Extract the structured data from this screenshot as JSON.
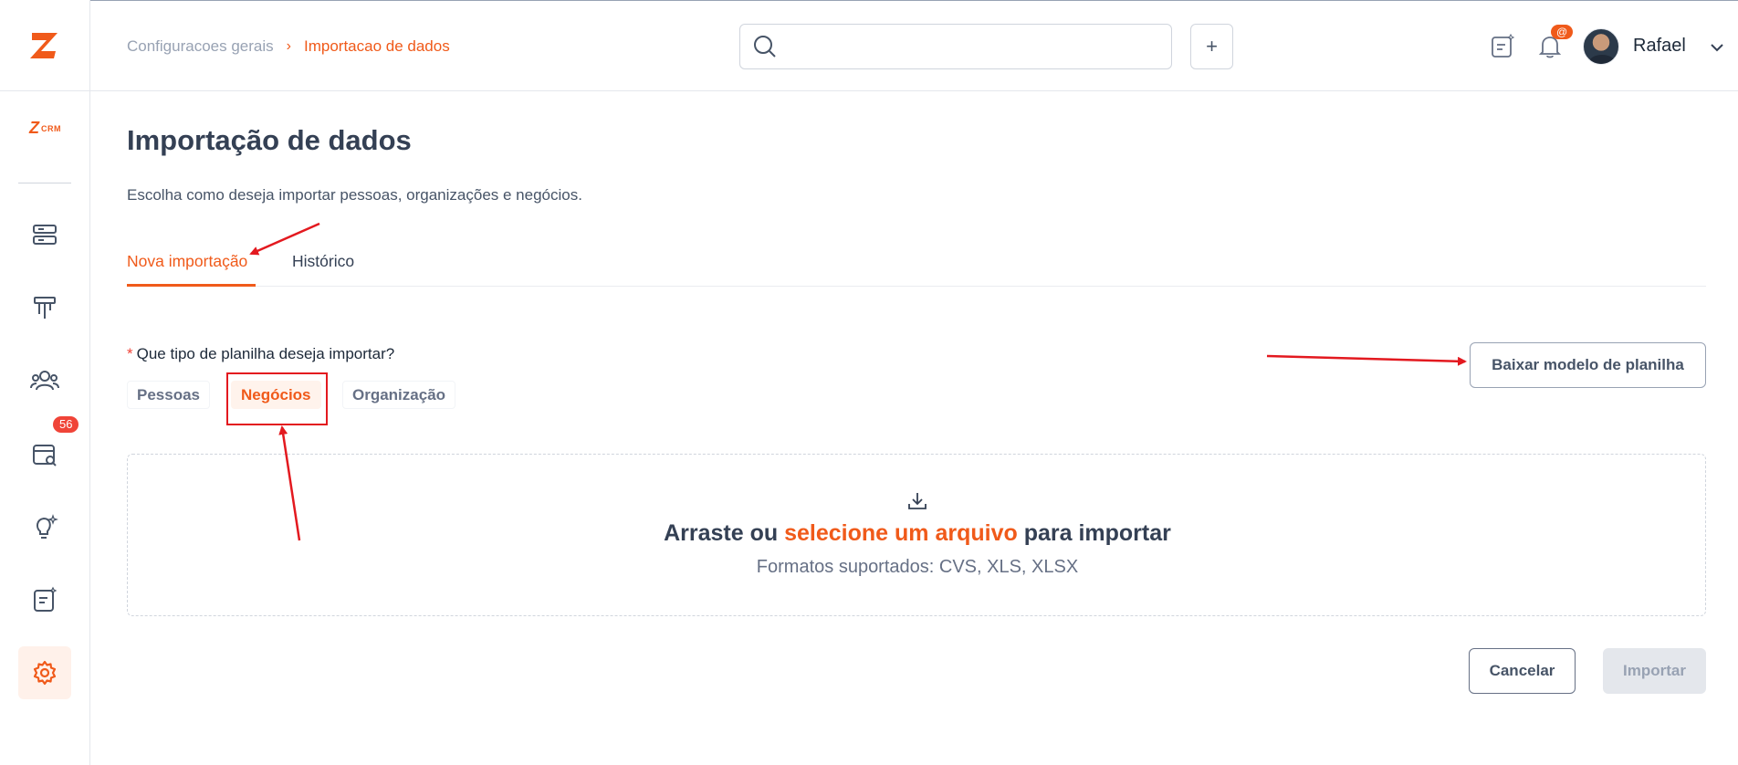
{
  "breadcrumb": {
    "parent": "Configuracoes gerais",
    "separator": "›",
    "current": "Importacao de dados"
  },
  "header": {
    "search_placeholder": "",
    "add_label": "+",
    "mention_badge": "@",
    "user_name": "Rafael"
  },
  "sidebar": {
    "logo_z": "Z",
    "crm_label": "CRM",
    "calendar_badge": "56",
    "items": [
      "dashboard-icon",
      "pipeline-icon",
      "contacts-icon",
      "calendar-search-icon",
      "idea-icon",
      "notes-icon",
      "settings-icon"
    ],
    "active": "settings-icon"
  },
  "page": {
    "title": "Importação de dados",
    "subtitle": "Escolha como deseja importar pessoas, organizações e negócios."
  },
  "tabs": [
    {
      "label": "Nova importação",
      "active": true
    },
    {
      "label": "Histórico",
      "active": false
    }
  ],
  "form": {
    "required_mark": "*",
    "question": "Que tipo de planilha deseja importar?",
    "options": [
      {
        "label": "Pessoas",
        "selected": false
      },
      {
        "label": "Negócios",
        "selected": true
      },
      {
        "label": "Organização",
        "selected": false
      }
    ],
    "download_template_label": "Baixar modelo de planilha"
  },
  "dropzone": {
    "prefix": "Arraste ou",
    "link": "selecione um arquivo",
    "suffix": "para importar",
    "formats": "Formatos suportados: CVS, XLS, XLSX"
  },
  "actions": {
    "cancel_label": "Cancelar",
    "import_label": "Importar"
  },
  "colors": {
    "accent": "#f05a1a",
    "annotation": "#e3191f",
    "text": "#344054",
    "muted": "#98a2b3"
  }
}
